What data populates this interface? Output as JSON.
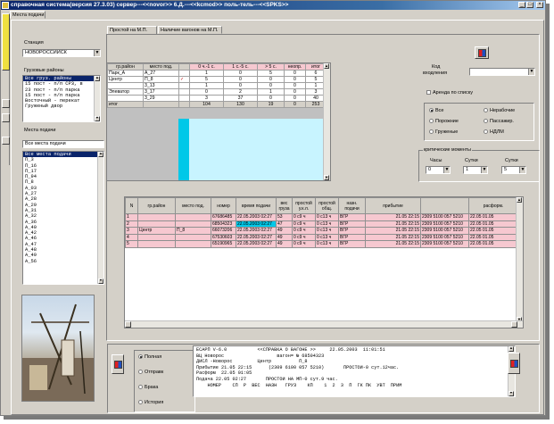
{
  "window": {
    "title": "справочная система(версия 27.3.03) сервер---<<novor>> 6.Д.---<<kcmod>> поль-тель---<<SPKS>>",
    "icon": "app-icon",
    "min_label": "_",
    "max_label": "□",
    "close_label": "×"
  },
  "main_tab": "Места подачи",
  "left_toolbar": [
    "yellow-book-icon",
    "wrench-icon",
    "pencil-icon",
    "blank-icon"
  ],
  "left": {
    "station_label": "Станция",
    "station_value": "НОВОРОССИЙСК",
    "cargo_areas_label": "Грузовые районы",
    "cargo_areas": [
      "Все груз. районы",
      "15 пост - п/п СРЗ, в",
      "23 пост - п/п парка",
      "15 пост - п/п парка",
      "Восточный - перекат",
      "Груженый двор"
    ],
    "places_label": "Места подачи",
    "places_combo": "Все места подачи",
    "places": [
      "Все места подачи",
      "П_3",
      "П_16",
      "П_17",
      "П_94",
      "П_8",
      "А_03",
      "А_27",
      "А_28",
      "А_29",
      "А_31",
      "А_32",
      "А_36",
      "А_40",
      "А_42",
      "А_46",
      "А_47",
      "А_48",
      "А_49",
      "А_56"
    ],
    "photo": "port-crane-photo"
  },
  "tabs": [
    "Простой на М.П.",
    "Наличие вагонов на М.П."
  ],
  "summary": {
    "headers": [
      "гр.район",
      "место под.",
      "",
      "0 ч.-1 с.",
      "1 с.-5 с.",
      "> 5 с.",
      "неопр.",
      "итог"
    ],
    "rows": [
      [
        "Парк_А",
        "А_27",
        "",
        "1",
        "0",
        "5",
        "0",
        "6"
      ],
      [
        "Центр",
        "П_8",
        "✓",
        "5",
        "0",
        "0",
        "0",
        "5"
      ],
      [
        "",
        "3_13",
        "",
        "1",
        "0",
        "0",
        "0",
        "1"
      ],
      [
        "Элеватор",
        "3_17",
        "",
        "0",
        "2",
        "1",
        "0",
        "3"
      ],
      [
        "",
        "3_29",
        "",
        "3",
        "37",
        "0",
        "0",
        "40"
      ],
      [
        "итог",
        "",
        "",
        "104",
        "130",
        "19",
        "0",
        "253"
      ]
    ]
  },
  "right": {
    "arrival_code_label": "Код",
    "arrival_code_label2": "входления",
    "arrival_code_value": "",
    "rent_label": "Аренда по списку",
    "filters": [
      "Все",
      "Нерабочие",
      "Порожние",
      "Пассажир.",
      "Груженые",
      "НДЛМ"
    ],
    "filter_selected": "Все",
    "critical_title": "критические моменты",
    "hours_label": "Часы",
    "days_label": "Сутки",
    "days2_label": "Сутки",
    "hours_value": "0",
    "days_value": "1",
    "days2_value": "5"
  },
  "detail": {
    "headers": [
      "N",
      "гр.район",
      "место под.",
      "номер",
      "время подачи",
      "вес груза",
      "простой у.к.л.",
      "простой общ.",
      "назн. подачи",
      "прибытие",
      "",
      "расформ."
    ],
    "rows": [
      [
        "1",
        "",
        "",
        "67686485",
        "22.05.2003 02:27",
        "53",
        "0 с9 ч",
        "0 с13 ч",
        "ВГР",
        "21.05 22:15",
        "2309 5100 057 5210",
        "22.05 01.05"
      ],
      [
        "2",
        "",
        "",
        "68504323",
        "22.05.2003 02:27",
        "47",
        "0 с9 ч",
        "0 с13 ч",
        "ВГР",
        "21.05 22:15",
        "2309 5100 057 5210",
        "22.05 01.05"
      ],
      [
        "3",
        "Центр",
        "П_8",
        "66073206",
        "22.05.2003 02:27",
        "49",
        "0 с9 ч",
        "0 с13 ч",
        "ВГР",
        "21.05 22:15",
        "2309 5100 057 5210",
        "22.05 01.05"
      ],
      [
        "4",
        "",
        "",
        "67530603",
        "22.05.2003 02:27",
        "49",
        "0 с9 ч",
        "0 с13 ч",
        "ВГР",
        "21.05 22:15",
        "2309 5100 057 5210",
        "22.05 01.05"
      ],
      [
        "5",
        "",
        "",
        "65190965",
        "22.05.2003 02:27",
        "49",
        "0 с9 ч",
        "0 с13 ч",
        "ВГР",
        "21.05 22:15",
        "2309 5100 057 5210",
        "22.05 01.05"
      ]
    ]
  },
  "bottom": {
    "modes": [
      "Полная",
      "Отправк",
      "Брака",
      "История"
    ],
    "mode_selected": "Полная",
    "message_lines": [
      "ЕСАРП V-6.0           <<СПРАВКА О ВАГОНЕ >>     22.05.2003  11:01:51",
      "ВЦ Новорос                   вагон= № 68504323",
      "ДИСЛ -Новорос         Центр          П_8",
      "Прибытие 21.05 22:15      (2309 6100 057 5210)       ПРОСТОЙ-0 сут.12час.",
      "Расформ  22.05 01:05",
      "Подача 22.05 02:27       ПРОСТОЙ НА МП-0 сут.9 час.",
      "    НОМЕР    СП  Р  ВЕС  НАЗН   ГРУЗ    КП    1  2  3  П  ГК ПК  УВТ  ПРИМ"
    ]
  }
}
